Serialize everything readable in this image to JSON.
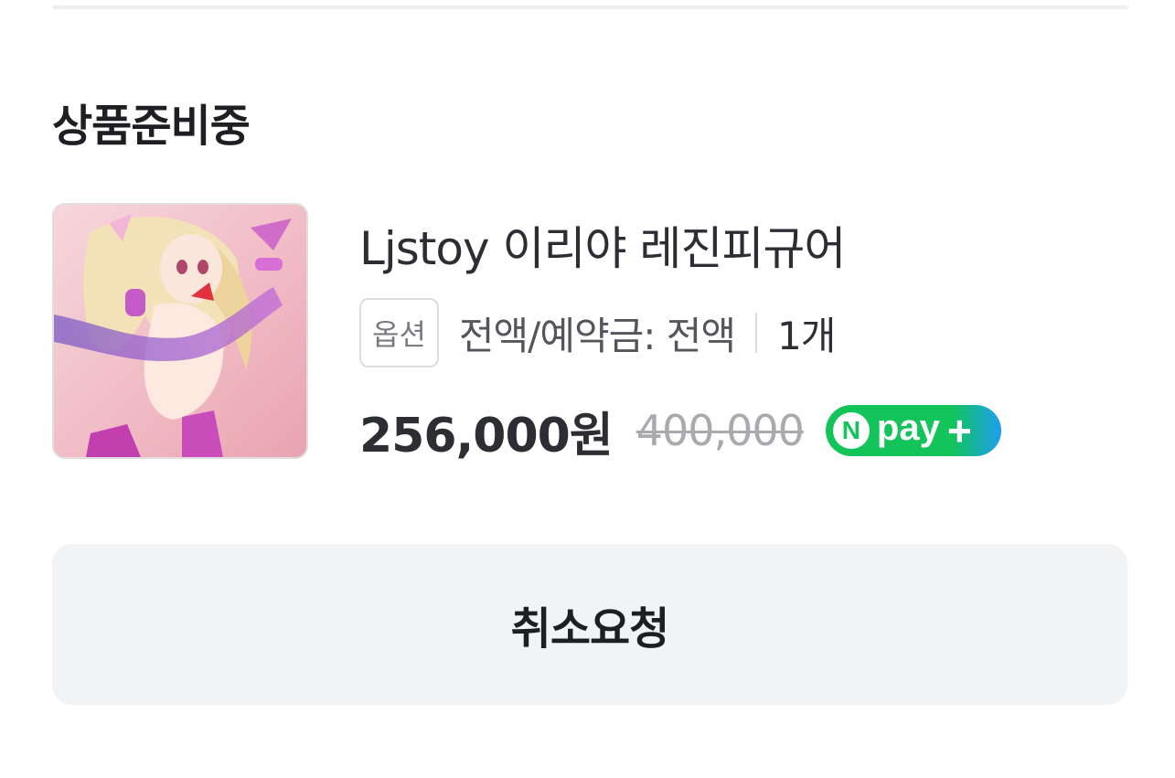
{
  "order": {
    "status_title": "상품준비중",
    "product": {
      "name": "Ljstoy 이리야 레진피규어",
      "image_alt": "Ljstoy 이리야 레진피규어",
      "option_chip": "옵션",
      "option_text": "전액/예약금: 전액",
      "quantity": "1개",
      "price": "256,000원",
      "original_price": "400,000",
      "payment_badge": {
        "logo_letter": "N",
        "label": "pay",
        "plus": "+"
      }
    },
    "cancel_button_label": "취소요청"
  },
  "colors": {
    "npay_green": "#12c45a",
    "npay_blue": "#1e9ef0",
    "button_bg": "#f2f3f5"
  }
}
